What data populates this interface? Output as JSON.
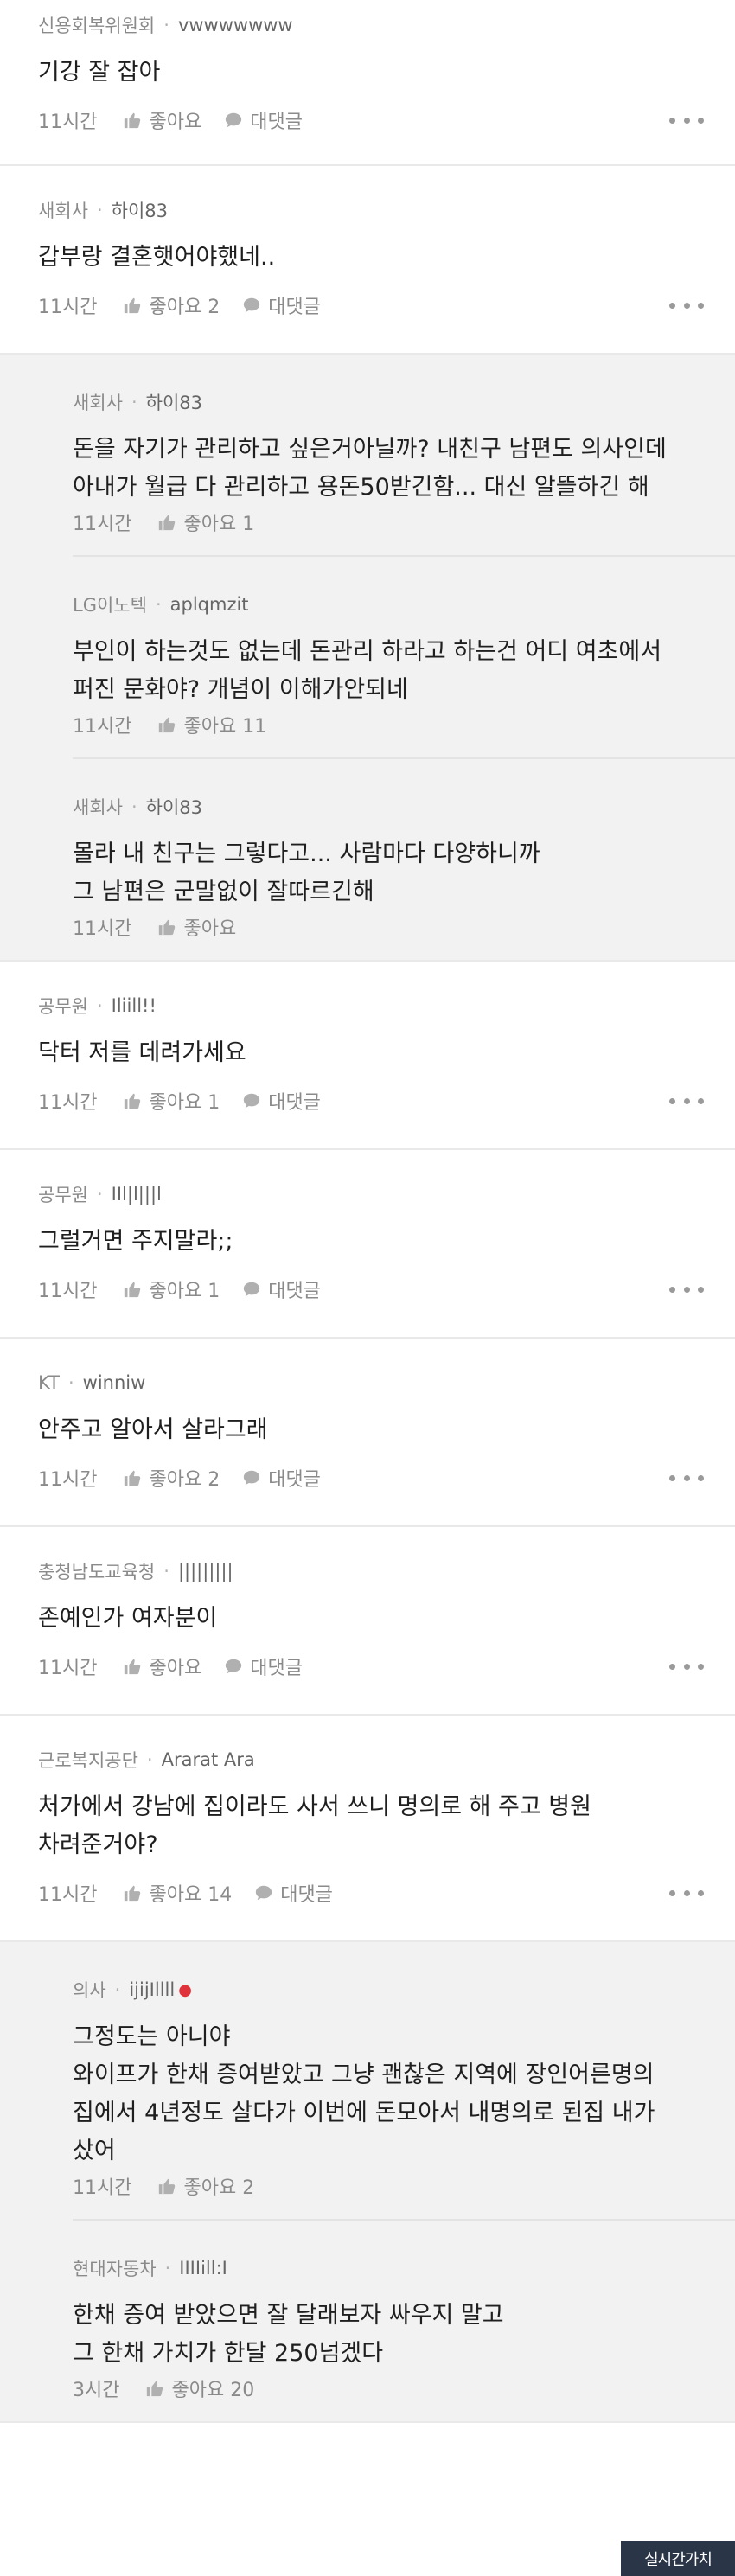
{
  "labels": {
    "like": "좋아요",
    "reply": "대댓글"
  },
  "comments": [
    {
      "company": "신용회복위원회",
      "nick": "vwwwwwww",
      "text": "기강 잘 잡아",
      "time": "11시간",
      "likes": "좋아요"
    },
    {
      "company": "새회사",
      "nick": "하이83",
      "text": "갑부랑 결혼햇어야했네..",
      "time": "11시간",
      "likes": "좋아요 2",
      "replies": [
        {
          "company": "새회사",
          "nick": "하이83",
          "text": "돈을 자기가 관리하고 싶은거아닐까? 내친구 남편도 의사인데 아내가 월급 다 관리하고 용돈50받긴함... 대신 알뜰하긴 해",
          "time": "11시간",
          "likes": "좋아요 1"
        },
        {
          "company": "LG이노텍",
          "nick": "aplqmzit",
          "text": "부인이 하는것도 없는데 돈관리 하라고 하는건 어디 여초에서 퍼진 문화야? 개념이 이해가안되네",
          "time": "11시간",
          "likes": "좋아요 11"
        },
        {
          "company": "새회사",
          "nick": "하이83",
          "text": "몰라 내 친구는 그렇다고... 사람마다 다양하니까\n그 남편은 군말없이 잘따르긴해",
          "time": "11시간",
          "likes": "좋아요"
        }
      ]
    },
    {
      "company": "공무원",
      "nick": "Iliill!!",
      "text": "닥터 저를 데려가세요",
      "time": "11시간",
      "likes": "좋아요 1"
    },
    {
      "company": "공무원",
      "nick": "IIl|l|||l",
      "text": "그럴거면 주지말라;;",
      "time": "11시간",
      "likes": "좋아요 1"
    },
    {
      "company": "KT",
      "nick": "winniw",
      "text": "안주고 알아서 살라그래",
      "time": "11시간",
      "likes": "좋아요 2"
    },
    {
      "company": "충청남도교육청",
      "nick": "|||||||||",
      "text": "존예인가 여자분이",
      "time": "11시간",
      "likes": "좋아요"
    },
    {
      "company": "근로복지공단",
      "nick": "Ararat Ara",
      "text": "처가에서 강남에 집이라도 사서 쓰니 명의로 해 주고 병원 차려준거야?",
      "time": "11시간",
      "likes": "좋아요 14",
      "replies": [
        {
          "company": "의사",
          "nick": "ijijIllll",
          "badge": "●",
          "text": "그정도는 아니야\n와이프가 한채 증여받았고 그냥 괜찮은 지역에 장인어른명의 집에서 4년정도 살다가 이번에 돈모아서 내명의로 된집 내가 샀어",
          "time": "11시간",
          "likes": "좋아요 2"
        },
        {
          "company": "현대자동차",
          "nick": "IIIIill:I",
          "text": "한채 증여 받았으면 잘 달래보자 싸우지 말고\n그 한채 가치가 한달 250넘겠다",
          "time": "3시간",
          "likes": "좋아요 20"
        }
      ]
    }
  ],
  "watermark": "실시간가치"
}
